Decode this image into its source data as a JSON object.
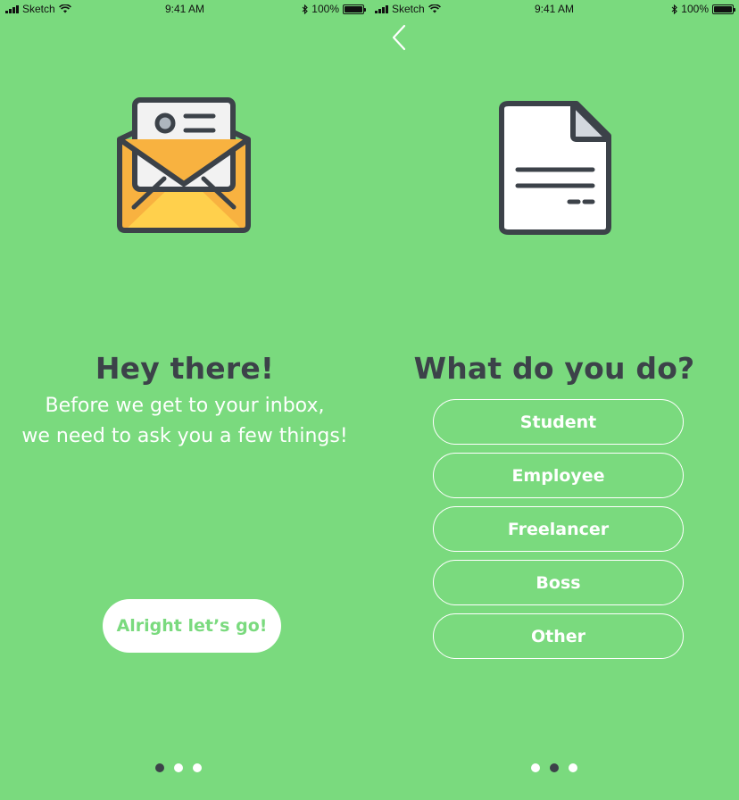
{
  "status_bar": {
    "carrier": "Sketch",
    "time": "9:41 AM",
    "battery": "100%"
  },
  "screen1": {
    "illustration": "envelope-letter-icon",
    "title": "Hey there!",
    "subtitle_line1": "Before we get to your inbox,",
    "subtitle_line2": "we need to ask you a few things!",
    "cta_label": "Alright let’s go!",
    "page_indicator": {
      "count": 3,
      "active": 1
    }
  },
  "screen2": {
    "back_icon": "chevron-left-icon",
    "illustration": "document-icon",
    "title": "What do you do?",
    "options": [
      "Student",
      "Employee",
      "Freelancer",
      "Boss",
      "Other"
    ],
    "page_indicator": {
      "count": 3,
      "active": 2
    }
  },
  "colors": {
    "background": "#7ADA7E",
    "text_dark": "#3C4249",
    "white": "#FFFFFF",
    "envelope_yellow": "#FFD04C",
    "envelope_orange": "#F8B240"
  }
}
